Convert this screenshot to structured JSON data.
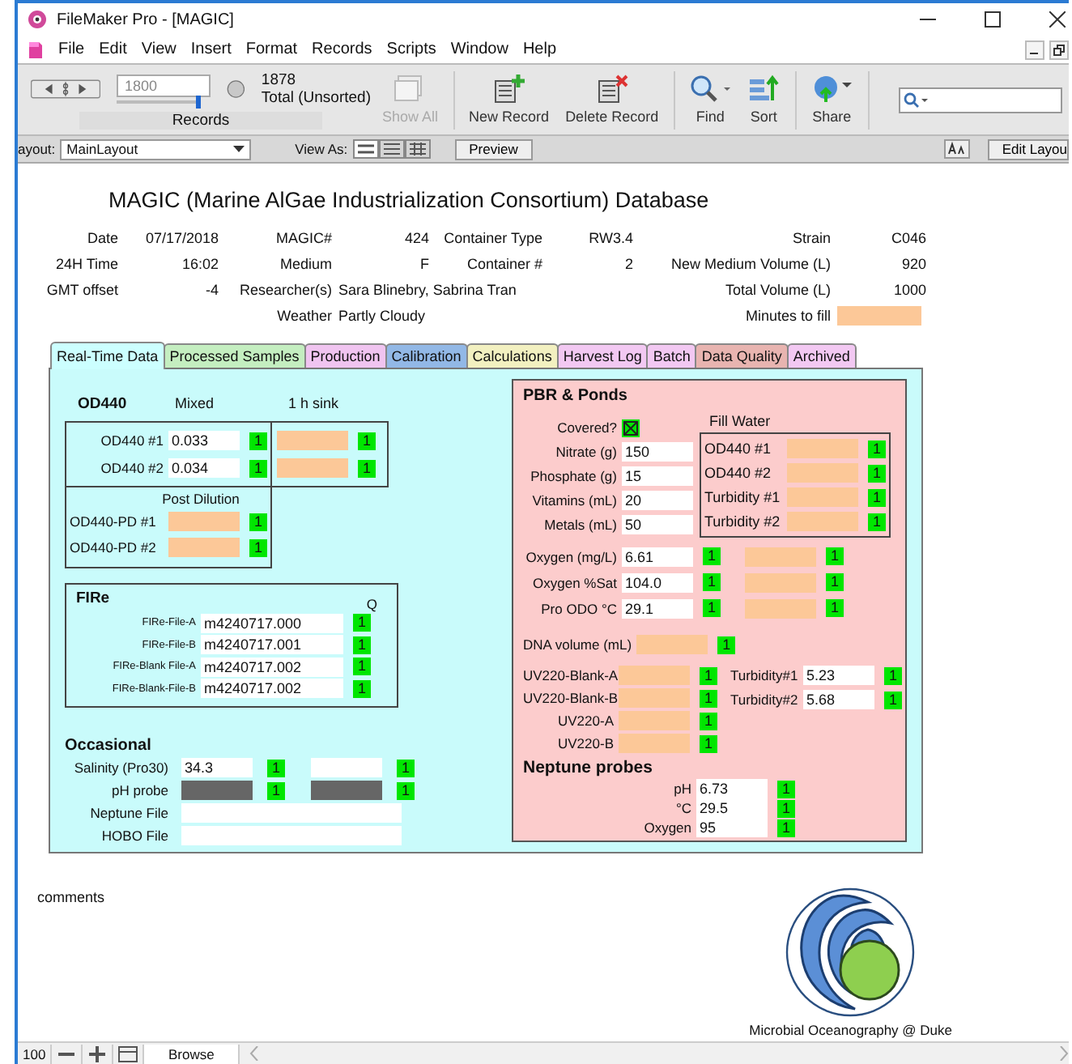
{
  "window": {
    "title": "FileMaker Pro - [MAGIC]"
  },
  "menu": [
    "File",
    "Edit",
    "View",
    "Insert",
    "Format",
    "Records",
    "Scripts",
    "Window",
    "Help"
  ],
  "toolbar": {
    "record": "1800",
    "record_slider": {
      "level": 0.95
    },
    "found_count": "1878",
    "found_label": "Total (Unsorted)",
    "records_label": "Records",
    "buttons": [
      {
        "kind": "show_all",
        "label": "Show All",
        "disabled": true
      },
      {
        "kind": "new_record",
        "label": "New Record",
        "disabled": false
      },
      {
        "kind": "delete_record",
        "label": "Delete Record",
        "disabled": false
      },
      {
        "kind": "find",
        "label": "Find",
        "disabled": false
      },
      {
        "kind": "sort",
        "label": "Sort",
        "disabled": false
      },
      {
        "kind": "share",
        "label": "Share",
        "disabled": false
      }
    ]
  },
  "layout_bar": {
    "layout_label": "ayout:",
    "layout": "MainLayout",
    "view_as_label": "View As:",
    "view_modes": [
      {
        "kind": "form",
        "selected": true
      },
      {
        "kind": "list",
        "selected": false
      },
      {
        "kind": "table",
        "selected": false
      }
    ],
    "preview": "Preview",
    "edit_layout": "Edit Layou"
  },
  "header": {
    "title": "MAGIC (Marine AlGae Industrialization Consortium) Database",
    "rows": [
      [
        {
          "label": "Date",
          "value": "07/17/2018"
        },
        {
          "label": "MAGIC#",
          "value": "424"
        },
        {
          "label": "Container Type",
          "value": "RW3.4"
        },
        {
          "label": "Strain",
          "value": "C046"
        }
      ],
      [
        {
          "label": "24H Time",
          "value": "16:02"
        },
        {
          "label": "Medium",
          "value": "F"
        },
        {
          "label": "Container #",
          "value": "2"
        },
        {
          "label": "New Medium Volume (L)",
          "value": "920"
        }
      ],
      [
        {
          "label": "GMT offset",
          "value": "-4"
        },
        {
          "label": "Researcher(s)",
          "value": "Sara Blinebry, Sabrina Tran"
        },
        null,
        {
          "label": "Total Volume (L)",
          "value": "1000"
        }
      ],
      [
        null,
        {
          "label": "Weather",
          "value": "Partly Cloudy"
        },
        null,
        {
          "label": "Minutes to fill",
          "kind": "blank"
        }
      ]
    ]
  },
  "tabs": [
    {
      "label": "Real-Time Data",
      "color": "#ccffff",
      "selected": true
    },
    {
      "label": "Processed Samples",
      "color": "#c4eec0",
      "selected": false
    },
    {
      "label": "Production",
      "color": "#f0c4f0",
      "selected": false
    },
    {
      "label": "Calibration",
      "color": "#92b8e6",
      "selected": false
    },
    {
      "label": "Calculations",
      "color": "#f2f0c0",
      "selected": false
    },
    {
      "label": "Harvest Log",
      "color": "#f2c8f2",
      "selected": false
    },
    {
      "label": "Batch",
      "color": "#f2c8f2",
      "selected": false
    },
    {
      "label": "Data Quality",
      "color": "#e8b4b0",
      "selected": false
    },
    {
      "label": "Archived",
      "color": "#f2c8f2",
      "selected": false
    }
  ],
  "od440": {
    "title": "OD440",
    "mixed_label": "Mixed",
    "sink_label": "1 h sink",
    "rows": [
      {
        "label": "OD440 #1",
        "mixed": {
          "kind": "text",
          "value": "0.033",
          "q": "1"
        },
        "sink": {
          "kind": "blank",
          "q": "1"
        }
      },
      {
        "label": "OD440 #2",
        "mixed": {
          "kind": "text",
          "value": "0.034",
          "q": "1"
        },
        "sink": {
          "kind": "blank",
          "q": "1"
        }
      }
    ],
    "post_dilution_label": "Post Dilution",
    "post_dilution": [
      {
        "label": "OD440-PD #1",
        "field": {
          "kind": "blank",
          "q": "1"
        }
      },
      {
        "label": "OD440-PD #2",
        "field": {
          "kind": "blank",
          "q": "1"
        }
      }
    ]
  },
  "fire": {
    "title": "FIRe",
    "q_label": "Q",
    "rows": [
      {
        "label": "FIRe-File-A",
        "field": {
          "kind": "text",
          "value": "m4240717.000",
          "q": "1"
        }
      },
      {
        "label": "FIRe-File-B",
        "field": {
          "kind": "text",
          "value": "m4240717.001",
          "q": "1"
        }
      },
      {
        "label": "FIRe-Blank File-A",
        "field": {
          "kind": "text",
          "value": "m4240717.002",
          "q": "1"
        }
      },
      {
        "label": "FIRe-Blank-File-B",
        "field": {
          "kind": "text",
          "value": "m4240717.002",
          "q": "1"
        }
      }
    ]
  },
  "occasional": {
    "title": "Occasional",
    "rows": [
      {
        "label": "Salinity (Pro30)",
        "fields": [
          {
            "kind": "text",
            "value": "34.3",
            "q": "1"
          },
          {
            "kind": "empty",
            "q": "1"
          }
        ]
      },
      {
        "label": "pH probe",
        "fields": [
          {
            "kind": "dark",
            "q": "1"
          },
          {
            "kind": "dark",
            "q": "1"
          }
        ]
      },
      {
        "label": "Neptune File",
        "fields": [
          {
            "kind": "wide"
          }
        ]
      },
      {
        "label": "HOBO File",
        "fields": [
          {
            "kind": "wide"
          }
        ]
      }
    ]
  },
  "pbr": {
    "title": "PBR & Ponds",
    "covered_label": "Covered?",
    "covered": true,
    "nutrients": [
      {
        "label": "Nitrate (g)",
        "value": "150"
      },
      {
        "label": "Phosphate (g)",
        "value": "15"
      },
      {
        "label": "Vitamins (mL)",
        "value": "20"
      },
      {
        "label": "Metals (mL)",
        "value": "50"
      }
    ],
    "fill_water_label": "Fill Water",
    "fill_water": [
      {
        "label": "OD440 #1",
        "field": {
          "kind": "blank",
          "q": "1"
        }
      },
      {
        "label": "OD440 #2",
        "field": {
          "kind": "blank",
          "q": "1"
        }
      },
      {
        "label": "Turbidity #1",
        "field": {
          "kind": "blank",
          "q": "1"
        }
      },
      {
        "label": "Turbidity #2",
        "field": {
          "kind": "blank",
          "q": "1"
        }
      }
    ],
    "oxygen": [
      {
        "label": "Oxygen (mg/L)",
        "fields": [
          {
            "kind": "text",
            "value": "6.61",
            "q": "1"
          },
          {
            "kind": "blank",
            "q": "1"
          }
        ]
      },
      {
        "label": "Oxygen %Sat",
        "fields": [
          {
            "kind": "text",
            "value": "104.0",
            "q": "1"
          },
          {
            "kind": "blank",
            "q": "1"
          }
        ]
      },
      {
        "label": "Pro ODO °C",
        "fields": [
          {
            "kind": "text",
            "value": "29.1",
            "q": "1"
          },
          {
            "kind": "blank",
            "q": "1"
          }
        ]
      }
    ],
    "dna": {
      "label": "DNA volume (mL)",
      "field": {
        "kind": "blank",
        "q": "1"
      }
    },
    "uv": [
      {
        "label": "UV220-Blank-A",
        "field": {
          "kind": "blank",
          "q": "1"
        }
      },
      {
        "label": "UV220-Blank-B",
        "field": {
          "kind": "blank",
          "q": "1"
        }
      },
      {
        "label": "UV220-A",
        "field": {
          "kind": "blank",
          "q": "1"
        }
      },
      {
        "label": "UV220-B",
        "field": {
          "kind": "blank",
          "q": "1"
        }
      }
    ],
    "turbidity": [
      {
        "label": "Turbidity#1",
        "field": {
          "kind": "text",
          "value": "5.23",
          "q": "1"
        }
      },
      {
        "label": "Turbidity#2",
        "field": {
          "kind": "text",
          "value": "5.68",
          "q": "1"
        }
      }
    ],
    "neptune_title": "Neptune probes",
    "neptune": [
      {
        "label": "pH",
        "field": {
          "kind": "text",
          "value": "6.73",
          "q": "1"
        }
      },
      {
        "label": "°C",
        "field": {
          "kind": "text",
          "value": "29.5",
          "q": "1"
        }
      },
      {
        "label": "Oxygen",
        "field": {
          "kind": "text",
          "value": "95",
          "q": "1"
        }
      }
    ]
  },
  "comments_label": "comments",
  "logo_caption": "Microbial Oceanography @ Duke",
  "status_bar": {
    "zoom": "100",
    "mode": "Browse"
  }
}
